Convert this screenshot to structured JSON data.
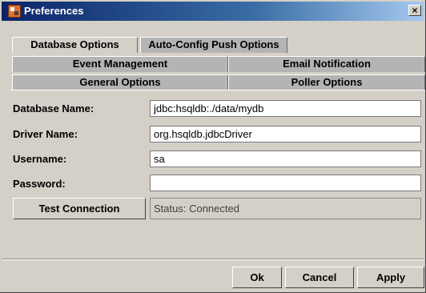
{
  "window": {
    "title": "Preferences",
    "close_label": "×"
  },
  "tabs": {
    "row_top": [
      "Database Options",
      "Auto-Config Push Options"
    ],
    "row_mid": [
      "Event Management",
      "Email Notification"
    ],
    "row_front": [
      "General Options",
      "Poller Options"
    ],
    "selected": "Database Options"
  },
  "form": {
    "database_name_label": "Database Name:",
    "database_name_value": "jdbc:hsqldb:./data/mydb",
    "driver_name_label": "Driver Name:",
    "driver_name_value": "org.hsqldb.jdbcDriver",
    "username_label": "Username:",
    "username_value": "sa",
    "password_label": "Password:",
    "password_value": "",
    "test_button": "Test Connection",
    "status_text": "Status: Connected"
  },
  "footer": {
    "ok": "Ok",
    "cancel": "Cancel",
    "apply": "Apply"
  }
}
